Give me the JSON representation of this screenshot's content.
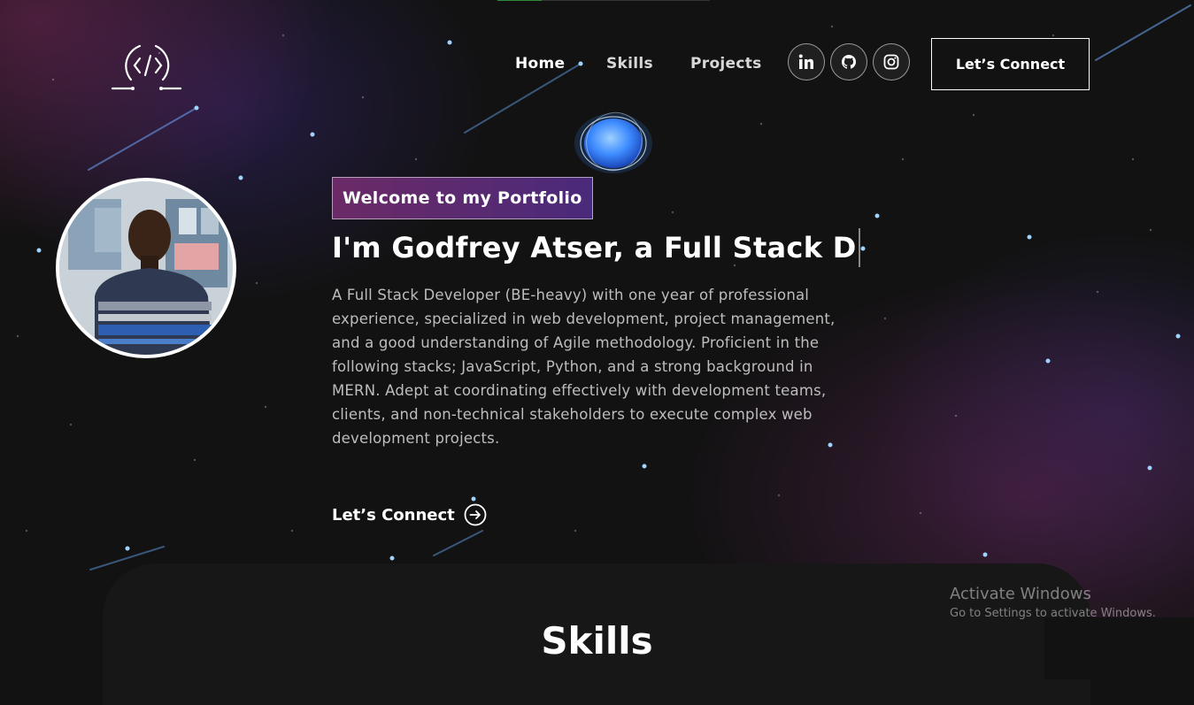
{
  "nav": {
    "links": [
      "Home",
      "Skills",
      "Projects"
    ],
    "social_icons": [
      "linkedin-icon",
      "github-icon",
      "instagram-icon"
    ],
    "connect_button": "Let’s Connect"
  },
  "hero": {
    "tagline": "Welcome to my Portfolio",
    "headline": "I'm Godfrey Atser, a Full Stack D",
    "intro": "A Full Stack Developer (BE-heavy) with one year of professional experience, specialized in web development, project management, and a good understanding of Agile methodology. Proficient in the following stacks; JavaScript, Python, and a strong background in MERN. Adept at coordinating effectively with development teams, clients, and non-technical stakeholders to execute complex web development projects.",
    "cta": "Let’s Connect"
  },
  "skills": {
    "title": "Skills"
  },
  "windows": {
    "title": "Activate Windows",
    "subtitle": "Go to Settings to activate Windows."
  },
  "colors": {
    "background": "#121212",
    "tagline_gradient_start": "#6b2a66",
    "tagline_gradient_end": "#4a2a7a",
    "orb_blue": "#3d8bff"
  }
}
